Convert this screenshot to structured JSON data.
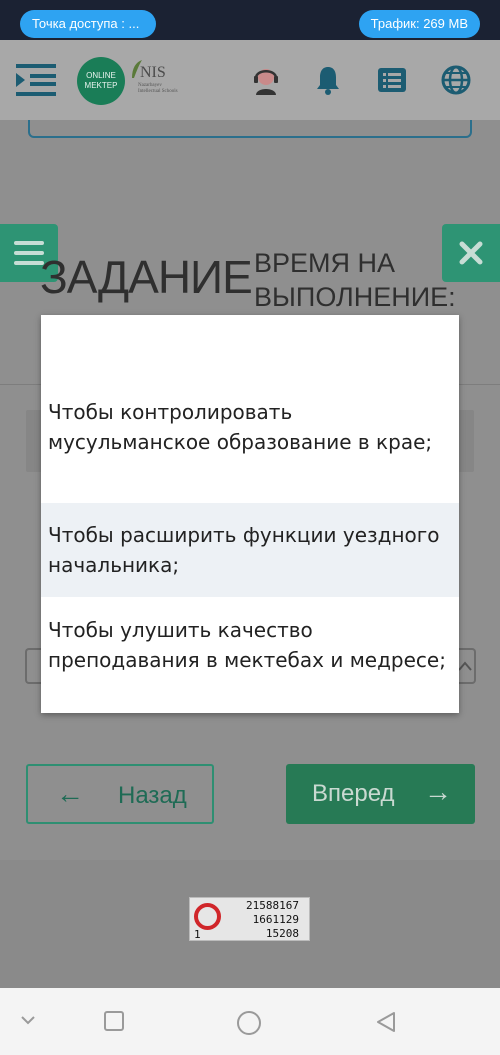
{
  "status_bar": {
    "hotspot_label": "Точка доступа : ...",
    "traffic_label": "Трафик: 269 MB"
  },
  "header": {
    "logo_online_line1": "ONLINE",
    "logo_online_line2": "MEKTEP",
    "logo_nis_title": "NIS",
    "logo_nis_sub": "Nazarbayev Intellectual Schools",
    "icons": [
      "menu-icon",
      "support-agent-icon",
      "bell-icon",
      "list-icon",
      "globe-icon"
    ]
  },
  "task": {
    "title": "ЗАДАНИЕ",
    "time_label_line1": "ВРЕМЯ НА",
    "time_label_line2": "ВЫПОЛНЕНИЕ:"
  },
  "dropdown": {
    "options": [
      "",
      "Чтобы контролировать мусульманское образование в крае;",
      "Чтобы расширить функции уездного начальника;",
      "Чтобы улушить качество преподавания в мектебах и медресе;"
    ],
    "highlighted_index": 2
  },
  "navigation": {
    "back_label": "Назад",
    "next_label": "Вперед"
  },
  "counter": {
    "line1": "21588167",
    "line2": "1661129",
    "line3": "15208",
    "left_digit": "1"
  },
  "colors": {
    "accent_green": "#2e9474",
    "status_bar": "#1b2233",
    "pill_blue": "#2ea3f2",
    "highlight": "#edf1f5"
  }
}
